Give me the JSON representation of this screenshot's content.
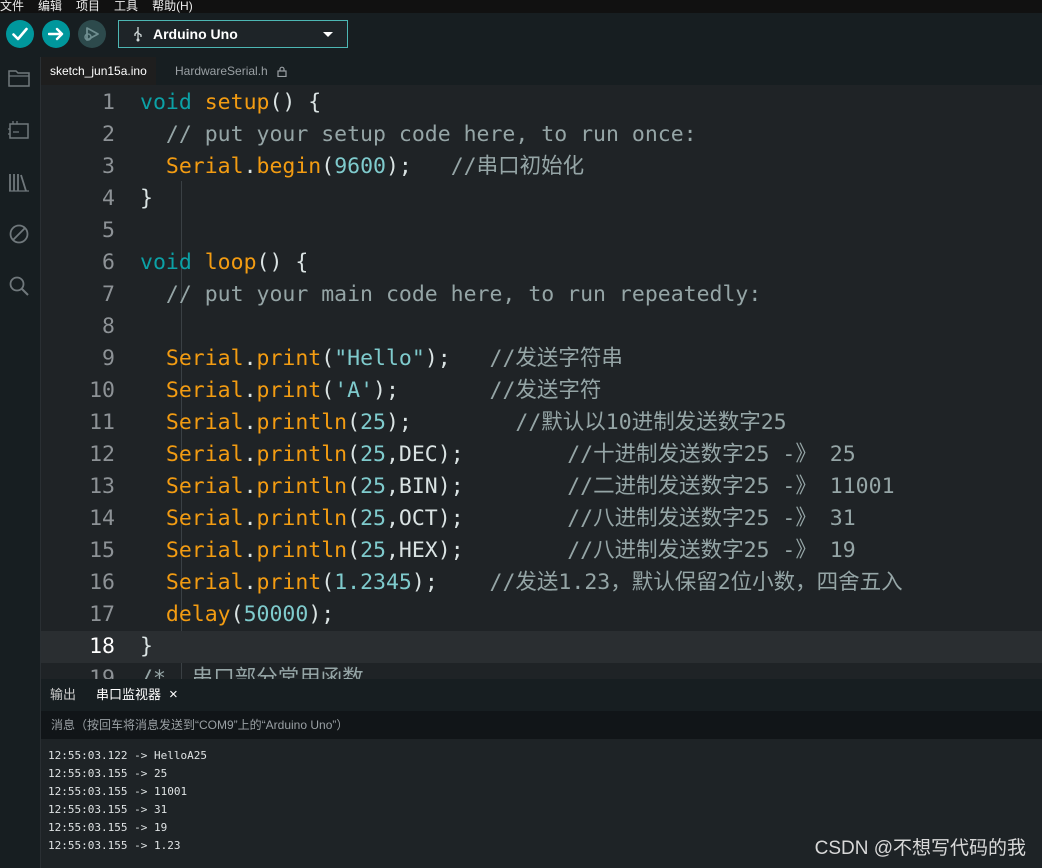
{
  "menu": [
    "文件",
    "编辑",
    "项目",
    "工具",
    "帮助(H)"
  ],
  "toolbar": {
    "verify_icon": "check-icon",
    "upload_icon": "arrow-right-icon",
    "debug_icon": "debug-icon",
    "board": "Arduino Uno",
    "accent": "#00979c"
  },
  "tabs": [
    {
      "label": "sketch_jun15a.ino",
      "active": true
    },
    {
      "label": "HardwareSerial.h",
      "active": false,
      "locked": true
    }
  ],
  "sidebar": [
    "folder-icon",
    "board-icon",
    "library-icon",
    "debug-off-icon",
    "search-icon"
  ],
  "editor": {
    "current_line": 18,
    "lines": [
      {
        "n": "1",
        "tokens": [
          [
            "kw",
            "void"
          ],
          [
            "t",
            " "
          ],
          [
            "fn",
            "setup"
          ],
          [
            "t",
            "() {"
          ]
        ]
      },
      {
        "n": "2",
        "tokens": [
          [
            "cm",
            "  // put your setup code here, to run once:"
          ]
        ]
      },
      {
        "n": "3",
        "tokens": [
          [
            "t",
            "  "
          ],
          [
            "fn",
            "Serial"
          ],
          [
            "t",
            "."
          ],
          [
            "fn",
            "begin"
          ],
          [
            "t",
            "("
          ],
          [
            "num",
            "9600"
          ],
          [
            "t",
            ");   "
          ],
          [
            "cm",
            "//串口初始化"
          ]
        ]
      },
      {
        "n": "4",
        "tokens": [
          [
            "t",
            "}"
          ]
        ]
      },
      {
        "n": "5",
        "tokens": []
      },
      {
        "n": "6",
        "tokens": [
          [
            "kw",
            "void"
          ],
          [
            "t",
            " "
          ],
          [
            "fn",
            "loop"
          ],
          [
            "t",
            "() {"
          ]
        ]
      },
      {
        "n": "7",
        "tokens": [
          [
            "cm",
            "  // put your main code here, to run repeatedly:"
          ]
        ]
      },
      {
        "n": "8",
        "tokens": []
      },
      {
        "n": "9",
        "tokens": [
          [
            "t",
            "  "
          ],
          [
            "fn",
            "Serial"
          ],
          [
            "t",
            "."
          ],
          [
            "fn",
            "print"
          ],
          [
            "t",
            "("
          ],
          [
            "str",
            "\"Hello\""
          ],
          [
            "t",
            ");   "
          ],
          [
            "cm",
            "//发送字符串"
          ]
        ]
      },
      {
        "n": "10",
        "tokens": [
          [
            "t",
            "  "
          ],
          [
            "fn",
            "Serial"
          ],
          [
            "t",
            "."
          ],
          [
            "fn",
            "print"
          ],
          [
            "t",
            "("
          ],
          [
            "str",
            "'A'"
          ],
          [
            "t",
            ");       "
          ],
          [
            "cm",
            "//发送字符"
          ]
        ]
      },
      {
        "n": "11",
        "tokens": [
          [
            "t",
            "  "
          ],
          [
            "fn",
            "Serial"
          ],
          [
            "t",
            "."
          ],
          [
            "fn",
            "println"
          ],
          [
            "t",
            "("
          ],
          [
            "num",
            "25"
          ],
          [
            "t",
            ");        "
          ],
          [
            "cm",
            "//默认以10进制发送数字25"
          ]
        ]
      },
      {
        "n": "12",
        "tokens": [
          [
            "t",
            "  "
          ],
          [
            "fn",
            "Serial"
          ],
          [
            "t",
            "."
          ],
          [
            "fn",
            "println"
          ],
          [
            "t",
            "("
          ],
          [
            "num",
            "25"
          ],
          [
            "t",
            ",DEC);        "
          ],
          [
            "cm",
            "//十进制发送数字25 -》 25"
          ]
        ]
      },
      {
        "n": "13",
        "tokens": [
          [
            "t",
            "  "
          ],
          [
            "fn",
            "Serial"
          ],
          [
            "t",
            "."
          ],
          [
            "fn",
            "println"
          ],
          [
            "t",
            "("
          ],
          [
            "num",
            "25"
          ],
          [
            "t",
            ",BIN);        "
          ],
          [
            "cm",
            "//二进制发送数字25 -》 11001"
          ]
        ]
      },
      {
        "n": "14",
        "tokens": [
          [
            "t",
            "  "
          ],
          [
            "fn",
            "Serial"
          ],
          [
            "t",
            "."
          ],
          [
            "fn",
            "println"
          ],
          [
            "t",
            "("
          ],
          [
            "num",
            "25"
          ],
          [
            "t",
            ",OCT);        "
          ],
          [
            "cm",
            "//八进制发送数字25 -》 31"
          ]
        ]
      },
      {
        "n": "15",
        "tokens": [
          [
            "t",
            "  "
          ],
          [
            "fn",
            "Serial"
          ],
          [
            "t",
            "."
          ],
          [
            "fn",
            "println"
          ],
          [
            "t",
            "("
          ],
          [
            "num",
            "25"
          ],
          [
            "t",
            ",HEX);        "
          ],
          [
            "cm",
            "//八进制发送数字25 -》 19"
          ]
        ]
      },
      {
        "n": "16",
        "tokens": [
          [
            "t",
            "  "
          ],
          [
            "fn",
            "Serial"
          ],
          [
            "t",
            "."
          ],
          [
            "fn",
            "print"
          ],
          [
            "t",
            "("
          ],
          [
            "num",
            "1.2345"
          ],
          [
            "t",
            ");    "
          ],
          [
            "cm",
            "//发送1.23，默认保留2位小数，四舍五入"
          ]
        ]
      },
      {
        "n": "17",
        "tokens": [
          [
            "t",
            "  "
          ],
          [
            "fn",
            "delay"
          ],
          [
            "t",
            "("
          ],
          [
            "num",
            "50000"
          ],
          [
            "t",
            ");"
          ]
        ]
      },
      {
        "n": "18",
        "tokens": [
          [
            "t",
            "}"
          ]
        ]
      },
      {
        "n": "19",
        "tokens": [
          [
            "cm",
            "/*  串口部分常用函数"
          ]
        ]
      }
    ]
  },
  "panel": {
    "tab_output": "输出",
    "tab_serial": "串口监视器",
    "close": "×",
    "message_placeholder": "消息（按回车将消息发送到“COM9”上的“Arduino Uno”）",
    "lines": [
      "12:55:03.122 -> HelloA25",
      "12:55:03.155 -> 25",
      "12:55:03.155 -> 11001",
      "12:55:03.155 -> 31",
      "12:55:03.155 -> 19",
      "12:55:03.155 -> 1.23"
    ]
  },
  "watermark": "CSDN @不想写代码的我"
}
